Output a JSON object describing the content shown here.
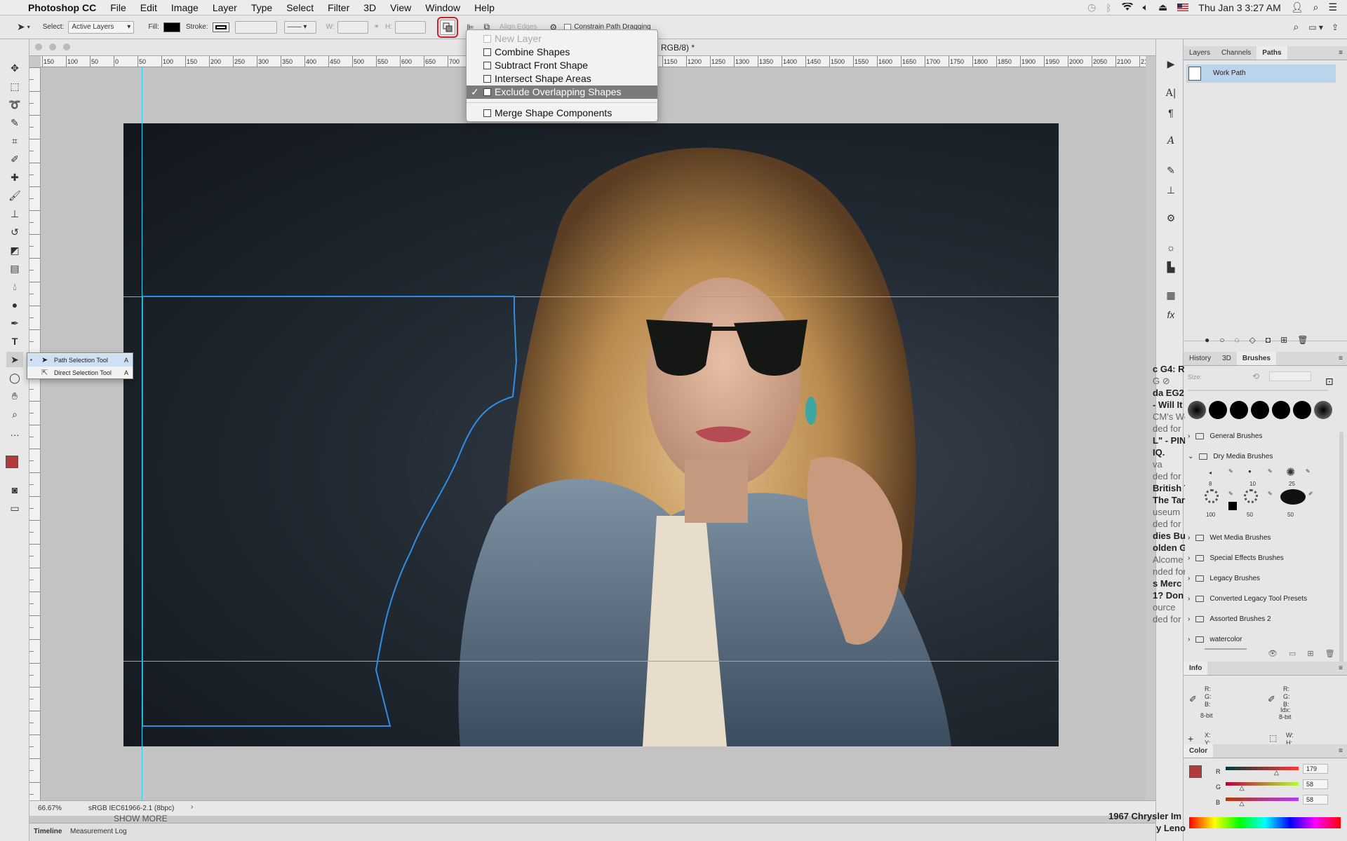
{
  "menubar": {
    "app": "Photoshop CC",
    "items": [
      "File",
      "Edit",
      "Image",
      "Layer",
      "Type",
      "Select",
      "Filter",
      "3D",
      "View",
      "Window",
      "Help"
    ],
    "clock": "Thu Jan 3  3:27 AM"
  },
  "options": {
    "select_label": "Select:",
    "select_value": "Active Layers",
    "fill_label": "Fill:",
    "stroke_label": "Stroke:",
    "w_label": "W:",
    "h_label": "H:",
    "align_edges": "Align Edges",
    "constrain": "Constrain Path Dragging",
    "fill_color": "#000000"
  },
  "document": {
    "tab_suffix": "RGB/8) *",
    "zoom": "66.67%",
    "profile": "sRGB IEC61966-2.1 (8bpc)",
    "show_more": "SHOW MORE"
  },
  "ruler_h": [
    "150",
    "100",
    "50",
    "0",
    "50",
    "100",
    "150",
    "200",
    "250",
    "300",
    "350",
    "400",
    "450",
    "500",
    "550",
    "600",
    "650",
    "700",
    "750",
    "800",
    "850",
    "900",
    "950",
    "1000",
    "1050",
    "1100",
    "1150",
    "1200",
    "1250",
    "1300",
    "1350",
    "1400",
    "1450",
    "1500",
    "1550",
    "1600",
    "1650",
    "1700",
    "1750",
    "1800",
    "1850",
    "1900",
    "1950",
    "2000",
    "2050",
    "2100",
    "215"
  ],
  "path_ops_menu": {
    "items": [
      {
        "label": "New Layer",
        "state": "disabled"
      },
      {
        "label": "Combine Shapes",
        "state": "normal"
      },
      {
        "label": "Subtract Front Shape",
        "state": "normal"
      },
      {
        "label": "Intersect Shape Areas",
        "state": "normal"
      },
      {
        "label": "Exclude Overlapping Shapes",
        "state": "checked"
      },
      {
        "label": "Merge Shape Components",
        "state": "normal"
      }
    ],
    "checkmark": "✓"
  },
  "tool_flyout": {
    "items": [
      {
        "label": "Path Selection Tool",
        "key": "A"
      },
      {
        "label": "Direct Selection Tool",
        "key": "A"
      }
    ]
  },
  "layers_panel": {
    "tabs": [
      "Layers",
      "Channels",
      "Paths"
    ],
    "work_path": "Work Path"
  },
  "brushes_panel": {
    "tabs": [
      "History",
      "3D",
      "Brushes"
    ],
    "size_label": "Size:",
    "folders": [
      "General Brushes",
      "Dry Media Brushes",
      "Wet Media Brushes",
      "Special Effects Brushes",
      "Legacy Brushes",
      "Converted Legacy Tool Presets",
      "Assorted Brushes 2",
      "watercolor"
    ],
    "preset_sizes_row1": [
      "8",
      "10",
      "25"
    ],
    "preset_sizes_row2": [
      "100",
      "50",
      "50"
    ]
  },
  "info_panel": {
    "title": "Info",
    "r": "R:",
    "g": "G:",
    "b": "B:",
    "bit_left": "8-bit",
    "bit_right": "8-bit",
    "idx": "Idx:",
    "x": "X:",
    "y": "Y:",
    "w": "W:",
    "h": "H:"
  },
  "color_panel": {
    "title": "Color",
    "r_label": "R",
    "g_label": "G",
    "b_label": "B",
    "r": "179",
    "g": "58",
    "b": "58",
    "fg": "#b33a3a"
  },
  "bottom_tabs": [
    "Timeline",
    "Measurement Log"
  ],
  "behind_window": {
    "lines": [
      {
        "text": "c G4: R",
        "style": "b"
      },
      {
        "text": "G ⊘",
        "style": "s"
      },
      {
        "text": "da EG2",
        "style": "b"
      },
      {
        "text": "- Will It",
        "style": "b"
      },
      {
        "text": "CM's We",
        "style": "s"
      },
      {
        "text": "ded for",
        "style": "s"
      },
      {
        "text": "L\" - PIN",
        "style": "b"
      },
      {
        "text": "IQ.",
        "style": "b"
      },
      {
        "text": "va",
        "style": "s"
      },
      {
        "text": "ded for",
        "style": "s"
      },
      {
        "text": "British T",
        "style": "b"
      },
      {
        "text": "The Tar",
        "style": "b"
      },
      {
        "text": "useum",
        "style": "s"
      },
      {
        "text": "ded for",
        "style": "s"
      },
      {
        "text": "dies Bu",
        "style": "b"
      },
      {
        "text": "olden G",
        "style": "b"
      },
      {
        "text": "Alcome",
        "style": "s"
      },
      {
        "text": "nded for",
        "style": "s"
      },
      {
        "text": "s Merc",
        "style": "b"
      },
      {
        "text": "1? Don",
        "style": "b"
      },
      {
        "text": "ource",
        "style": "s"
      },
      {
        "text": "ded for",
        "style": "s"
      },
      {
        "text": "1967 Chrysler Im",
        "style": "b"
      },
      {
        "text": "y Leno",
        "style": "b"
      }
    ]
  }
}
